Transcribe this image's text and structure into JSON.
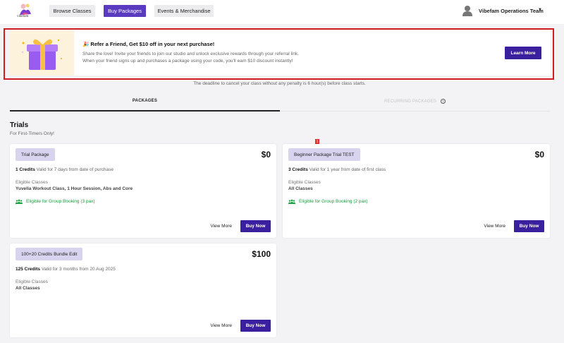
{
  "header": {
    "logo_text": "vibefam",
    "nav": [
      "Browse Classes",
      "Buy Packages",
      "Events & Merchandise"
    ],
    "user_name": "Vibefam Operations Team"
  },
  "banner": {
    "title": "🎉 Refer a Friend, Get $10 off in your next purchase!",
    "line1": "Share the love! Invite your friends to join our studio and unlock exclusive rewards through your referral link.",
    "line2": "When your friend signs up and purchases a package using your code, you'll earn $10 discount instantly!",
    "button": "Learn More"
  },
  "deadline_text": "The deadline to cancel your class without any penalty is 6 hour(s) before class starts.",
  "tabs": [
    "PACKAGES",
    "RECURRING PACKAGES"
  ],
  "section": {
    "title": "Trials",
    "subtitle": "For First-Timers Only!"
  },
  "badge_count": "1",
  "packages": [
    {
      "name": "Trial Package",
      "price": "$0",
      "credits": "1 Credits",
      "validity": "Valid for 7 days from date of purchase",
      "eligible_label": "Eligible Classes",
      "eligible_value": "Yuvella Workout Class, 1 Hour Session, Abs and Core",
      "group": "Eligible for Group Booking (3 pax)",
      "view_more": "View More",
      "buy": "Buy Now"
    },
    {
      "name": "Beginner Package Trial TEST",
      "price": "$0",
      "credits": "3 Credits",
      "validity": "Valid for 1 year from date of first class",
      "eligible_label": "Eligible Classes",
      "eligible_value": "All Classes",
      "group": "Eligible for Group Booking (2 pax)",
      "view_more": "View More",
      "buy": "Buy Now"
    },
    {
      "name": "100+20 Credits Bundle Edit",
      "price": "$100",
      "credits": "125 Credits",
      "validity": "Valid for 3 months from 20 Aug 2025",
      "eligible_label": "Eligible Classes",
      "eligible_value": "All Classes",
      "view_more": "View More",
      "buy": "Buy Now"
    }
  ],
  "colors": {
    "primary": "#3a1f9e",
    "nav_active": "#5a3bc0",
    "chip": "#d8d3ee",
    "success": "#1a9e3f",
    "highlight": "#d01c23"
  }
}
